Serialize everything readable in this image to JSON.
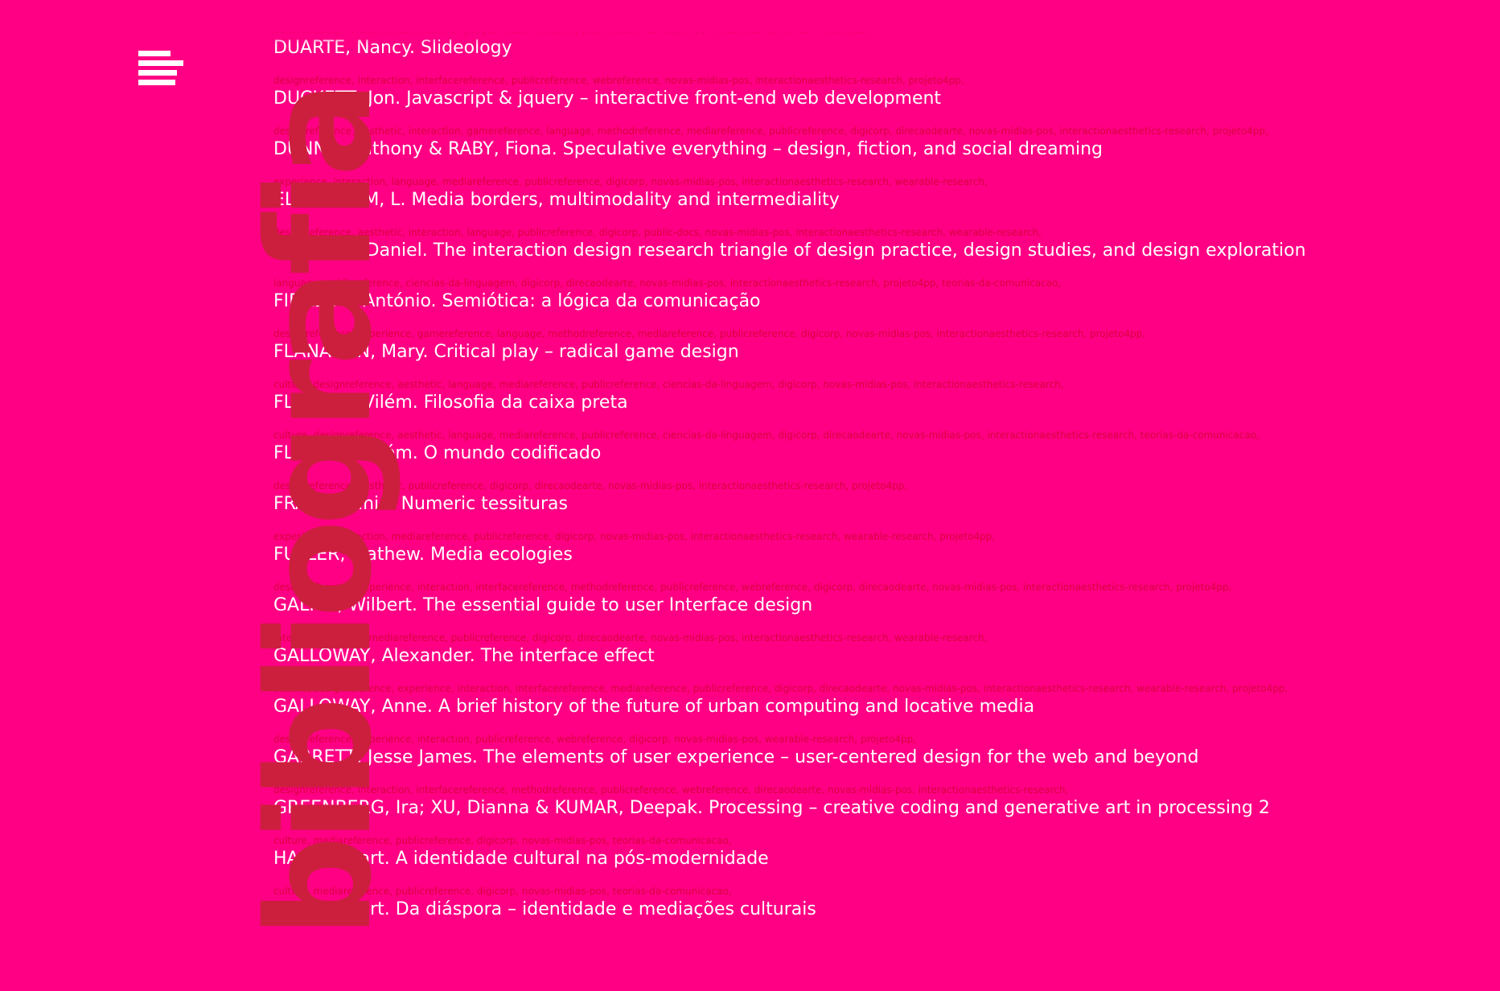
{
  "page": {
    "vertical_title": "bibliografia"
  },
  "entries": [
    {
      "tags": "culture, designreference, aesthetic, language, mediareference, publicreference, digicorp, direcaodearte, novas-midias-pos,",
      "title": "DUARTE, Nancy. Slideology"
    },
    {
      "tags": "designreference, interaction, interfacereference, publicreference, webreference, novas-midias-pos, interactionaesthetics-research, projeto4pp,",
      "title": "DUCKETT, Jon. Javascript & jquery – interactive front-end web development"
    },
    {
      "tags": "designreference, aesthetic, interaction, gamereference, language, methodreference, mediareference, publicreference, digicorp, direcaodearte, novas-midias-pos, interactionaesthetics-research, projeto4pp,",
      "title": "DUNNE, Anthony & RABY, Fiona. Speculative everything – design, fiction, and social dreaming"
    },
    {
      "tags": "experience, interaction, language, mediareference, publicreference, digicorp, novas-midias-pos, interactionaesthetics-research, wearable-research,",
      "title": "ELLESTRÖM, L. Media borders, multimodality and intermediality"
    },
    {
      "tags": "designreference, aesthetic, interaction, language, publicreference, digicorp, public-docs, novas-midias-pos, interactionaesthetics-research, wearable-research,",
      "title": "FALLMAN, Daniel. The interaction design research triangle of design practice, design studies, and design exploration"
    },
    {
      "tags": "language, publicreference, ciencias-da-linguagem, digicorp, direcaodearte, novas-midias-pos, interactionaesthetics-research, projeto4pp, teorias-da-comunicacao,",
      "title": "FIDALGO, António. Semiótica: a lógica da comunicação"
    },
    {
      "tags": "designreference, experience, gamereference, language, methodreference, mediareference, publicreference, digicorp, novas-midias-pos, interactionaesthetics-research, projeto4pp,",
      "title": "FLANAGAN, Mary. Critical play – radical game design"
    },
    {
      "tags": "culture, designreference, aesthetic, language, mediareference, publicreference, ciencias-da-linguagem, digicorp, novas-midias-pos, interactionaesthetics-research,",
      "title": "FLUSSER, Vilém. Filosofia da caixa preta"
    },
    {
      "tags": "culture, designreference, aesthetic, language, mediareference, publicreference, ciencias-da-linguagem, digicorp, direcaodearte, novas-midias-pos, interactionaesthetics-research, teorias-da-comunicacao,",
      "title": "FLUSSER, Vilém. O mundo codificado"
    },
    {
      "tags": "designreference, aesthetic, publicreference, digicorp, direcaodearte, novas-midias-pos, interactionaesthetics-research, projeto4pp,",
      "title": "FRAGA, Tania. Numeric tessituras"
    },
    {
      "tags": "experience, interaction, mediareference, publicreference, digicorp, novas-midias-pos, interactionaesthetics-research, wearable-research, projeto4pp,",
      "title": "FULLER, Mathew. Media ecologies"
    },
    {
      "tags": "designreference, experience, interaction, interfacereference, methodreference, publicreference, webreference, digicorp, direcaodearte, novas-midias-pos, interactionaesthetics-research, projeto4pp,",
      "title": "GALITZ, Wilbert. The essential guide to user Interface design"
    },
    {
      "tags": "interfacereference, mediareference, publicreference, digicorp, direcaodearte, novas-midias-pos, interactionaesthetics-research, wearable-research,",
      "title": "GALLOWAY, Alexander. The interface effect"
    },
    {
      "tags": "culture, designreference, experience, interaction, interfacereference, mediareference, publicreference, digicorp, direcaodearte, novas-midias-pos, interactionaesthetics-research, wearable-research, projeto4pp,",
      "title": "GALLOWAY, Anne. A brief history of the future of urban computing and locative media"
    },
    {
      "tags": "designreference, experience, interaction, publicreference, webreference, digicorp, novas-midias-pos, wearable-research, projeto4pp,",
      "title": "GARRETT, Jesse James. The elements of user experience – user-centered design for the web and beyond"
    },
    {
      "tags": "designreference, interaction, interfacereference, methodreference, publicreference, webreference, direcaodearte, novas-midias-pos, interactionaesthetics-research,",
      "title": "GREENBERG, Ira; XU, Dianna & KUMAR, Deepak. Processing – creative coding and generative art in processing 2"
    },
    {
      "tags": "culture, mediareference, publicreference, digicorp, novas-midias-pos, teorias-da-comunicacao,",
      "title": "HALL, Stuart. A identidade cultural na pós-modernidade"
    },
    {
      "tags": "culture, mediareference, publicreference, digicorp, novas-midias-pos, teorias-da-comunicacao,",
      "title": "HALL, Stuart. Da diáspora – identidade e mediações culturais"
    }
  ]
}
